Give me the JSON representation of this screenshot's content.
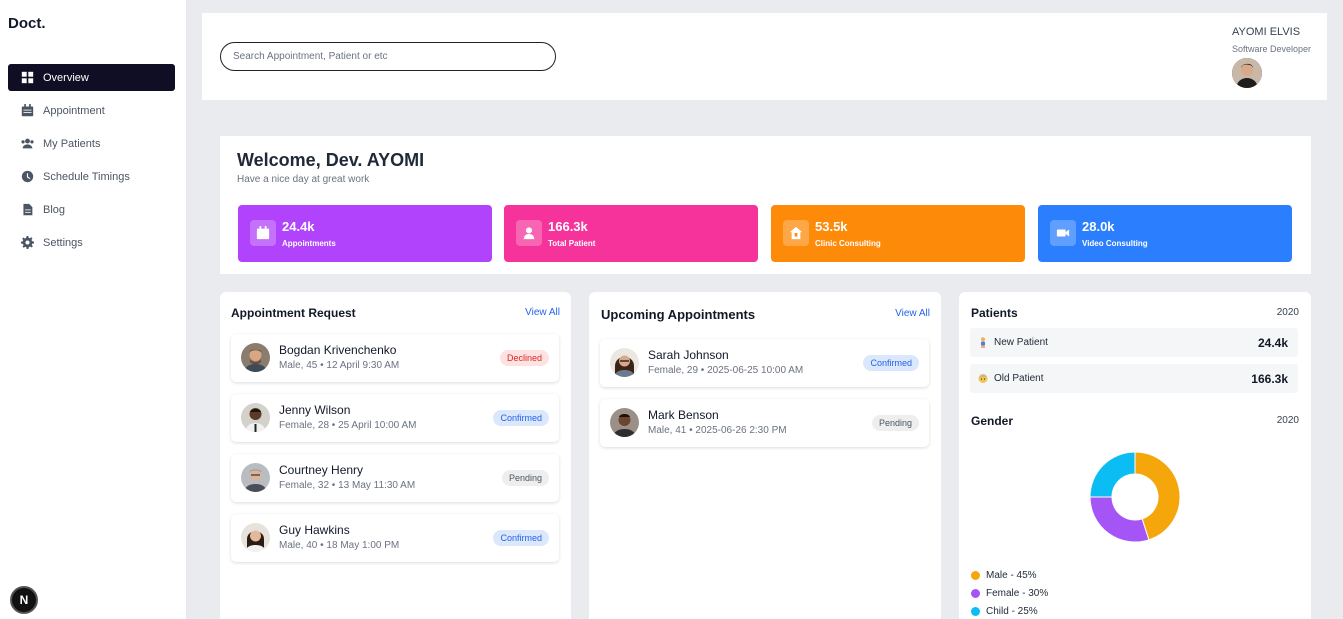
{
  "brand": "Doct.",
  "nav": [
    {
      "label": "Overview",
      "icon": "grid-icon",
      "active": true
    },
    {
      "label": "Appointment",
      "icon": "calendar-icon"
    },
    {
      "label": "My Patients",
      "icon": "users-icon"
    },
    {
      "label": "Schedule Timings",
      "icon": "clock-icon"
    },
    {
      "label": "Blog",
      "icon": "document-icon"
    },
    {
      "label": "Settings",
      "icon": "gear-icon"
    }
  ],
  "next_badge": "N",
  "header": {
    "search_placeholder": "Search Appointment, Patient or etc",
    "user_name": "AYOMI ELVIS",
    "user_role": "Software Developer"
  },
  "welcome": {
    "title": "Welcome, Dev. AYOMI",
    "subtitle": "Have a nice day at great work"
  },
  "stats": [
    {
      "value": "24.4k",
      "label": "Appointments",
      "color": "#b043fb",
      "icon": "calendar-icon"
    },
    {
      "value": "166.3k",
      "label": "Total Patient",
      "color": "#f6339a",
      "icon": "user-icon"
    },
    {
      "value": "53.5k",
      "label": "Clinic Consulting",
      "color": "#fe8a0a",
      "icon": "home-icon"
    },
    {
      "value": "28.0k",
      "label": "Video Consulting",
      "color": "#2b7fff",
      "icon": "video-icon"
    }
  ],
  "appointment_request": {
    "title": "Appointment Request",
    "view_all": "View All",
    "items": [
      {
        "name": "Bogdan Krivenchenko",
        "meta": "Male, 45 • 12 April 9:30 AM",
        "status": "Declined",
        "status_class": "declined"
      },
      {
        "name": "Jenny Wilson",
        "meta": "Female, 28 • 25 April 10:00 AM",
        "status": "Confirmed",
        "status_class": "confirmed"
      },
      {
        "name": "Courtney Henry",
        "meta": "Female, 32 • 13 May 11:30 AM",
        "status": "Pending",
        "status_class": "pending"
      },
      {
        "name": "Guy Hawkins",
        "meta": "Male, 40 • 18 May 1:00 PM",
        "status": "Confirmed",
        "status_class": "confirmed"
      }
    ]
  },
  "upcoming": {
    "title": "Upcoming Appointments",
    "view_all": "View All",
    "items": [
      {
        "name": "Sarah Johnson",
        "meta": "Female, 29 • 2025-06-25 10:00 AM",
        "status": "Confirmed",
        "status_class": "confirmed"
      },
      {
        "name": "Mark Benson",
        "meta": "Male, 41 • 2025-06-26 2:30 PM",
        "status": "Pending",
        "status_class": "pending"
      }
    ]
  },
  "patients": {
    "title": "Patients",
    "year": "2020",
    "rows": [
      {
        "label": "New Patient",
        "value": "24.4k",
        "icon": "person-icon"
      },
      {
        "label": "Old Patient",
        "value": "166.3k",
        "icon": "elder-icon"
      }
    ]
  },
  "gender": {
    "title": "Gender",
    "year": "2020",
    "legend": [
      "Male - 45%",
      "Female - 30%",
      "Child - 25%"
    ]
  },
  "chart_data": {
    "type": "pie",
    "categories": [
      "Male",
      "Female",
      "Child"
    ],
    "values": [
      45,
      30,
      25
    ],
    "colors": [
      "#f5a60b",
      "#a555f6",
      "#0cbdf3"
    ]
  }
}
